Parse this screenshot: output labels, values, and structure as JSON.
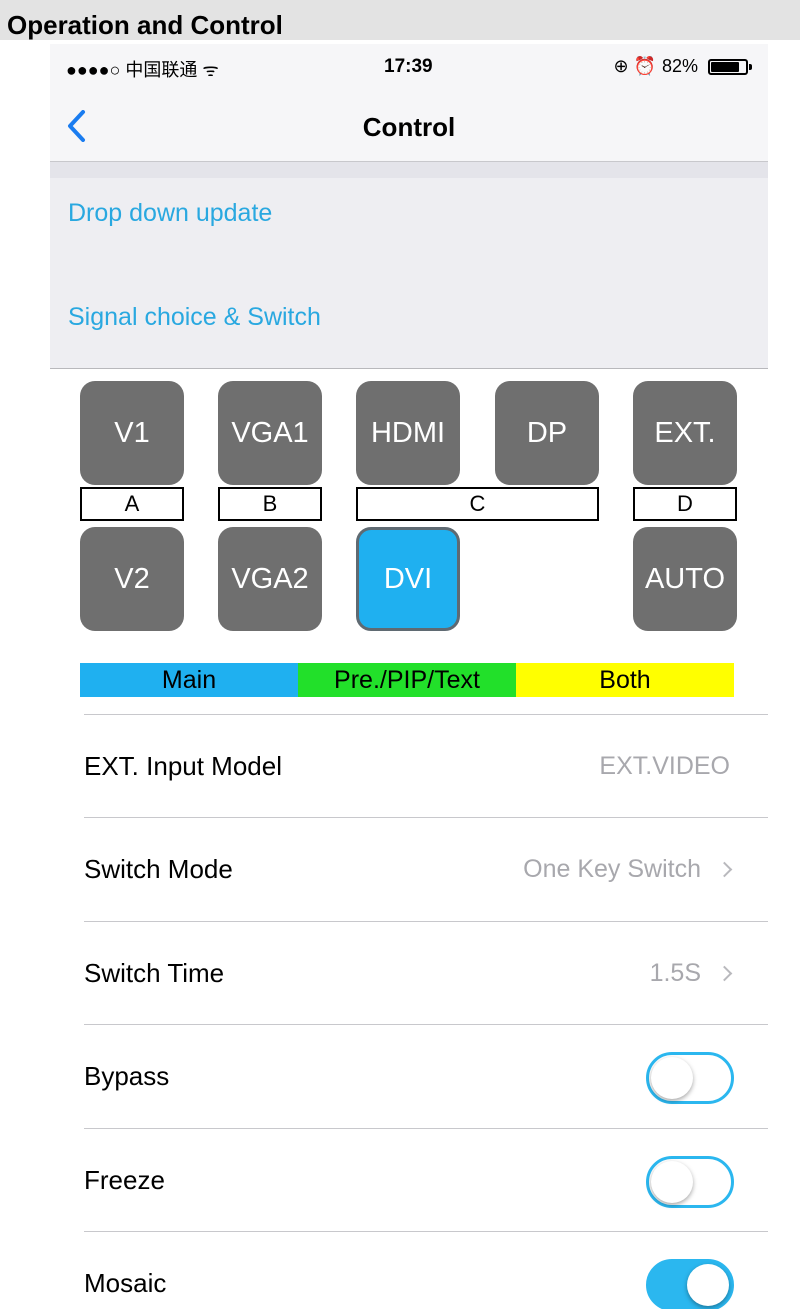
{
  "doc_title": "Operation and Control",
  "status_bar": {
    "carrier": "●●●●○ 中国联通 ᯤ",
    "time": "17:39",
    "icons": "⊕ ⏰",
    "battery_pct": "82%",
    "battery_level": 0.82
  },
  "nav": {
    "title": "Control",
    "back_icon": "chevron-left-icon"
  },
  "links": {
    "drop_down": "Drop down update",
    "signal_choice": "Signal choice & Switch"
  },
  "keys": {
    "v1": "V1",
    "vga1": "VGA1",
    "hdmi": "HDMI",
    "dp": "DP",
    "ext": "EXT.",
    "v2": "V2",
    "vga2": "VGA2",
    "dvi": "DVI",
    "auto": "AUTO"
  },
  "active_key": "DVI",
  "groups": {
    "a": "A",
    "b": "B",
    "c": "C",
    "d": "D"
  },
  "legend": {
    "main": "Main",
    "main_color": "#1fb0f0",
    "pip": "Pre./PIP/Text",
    "pip_color": "#22e02a",
    "both": "Both",
    "both_color": "#ffff00"
  },
  "settings": [
    {
      "label": "EXT. Input Model",
      "value": "EXT.VIDEO"
    },
    {
      "label": "Switch Mode",
      "value": "One Key Switch"
    },
    {
      "label": "Switch Time",
      "value": "1.5S"
    },
    {
      "label": "Bypass",
      "toggle_on": false
    },
    {
      "label": "Freeze",
      "toggle_on": false
    },
    {
      "label": "Mosaic",
      "toggle_on": true
    }
  ]
}
